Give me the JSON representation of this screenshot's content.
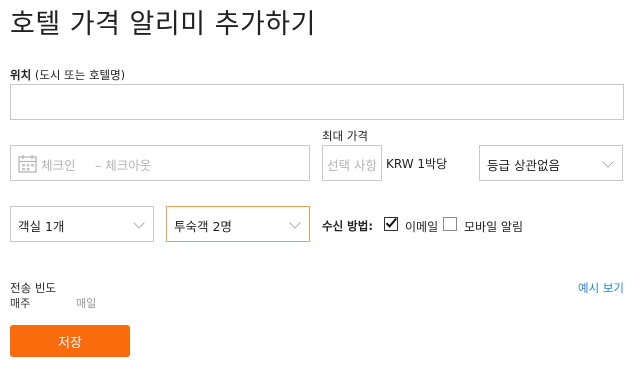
{
  "page_title": "호텔 가격 알리미 추가하기",
  "location": {
    "label": "위치",
    "hint": " (도시 또는 호텔명)",
    "value": ""
  },
  "dates": {
    "checkin_placeholder": "체크인",
    "checkout_placeholder": "– 체크아웃"
  },
  "max_price": {
    "label": "최대 가격",
    "placeholder": "선택 사항",
    "unit": "KRW 1박당"
  },
  "grade_select": {
    "value": "등급 상관없음"
  },
  "rooms_select": {
    "value": "객실 1개"
  },
  "guests_select": {
    "value": "투숙객 2명"
  },
  "notify": {
    "label": "수신 방법:",
    "email_label": "이메일",
    "email_checked": true,
    "mobile_label": "모바일 알림",
    "mobile_checked": false
  },
  "frequency": {
    "label": "전송 빈도",
    "options": [
      "매주",
      "매일"
    ],
    "selected": "매주"
  },
  "preview_link": "예시 보기",
  "save_button": "저장",
  "colors": {
    "accent": "#fa6b0e",
    "link": "#2a84d2",
    "guests_border": "#e8a25c"
  },
  "icons": {
    "calendar": "calendar-icon",
    "check": "check-icon",
    "chevron": "chevron-down-icon"
  }
}
